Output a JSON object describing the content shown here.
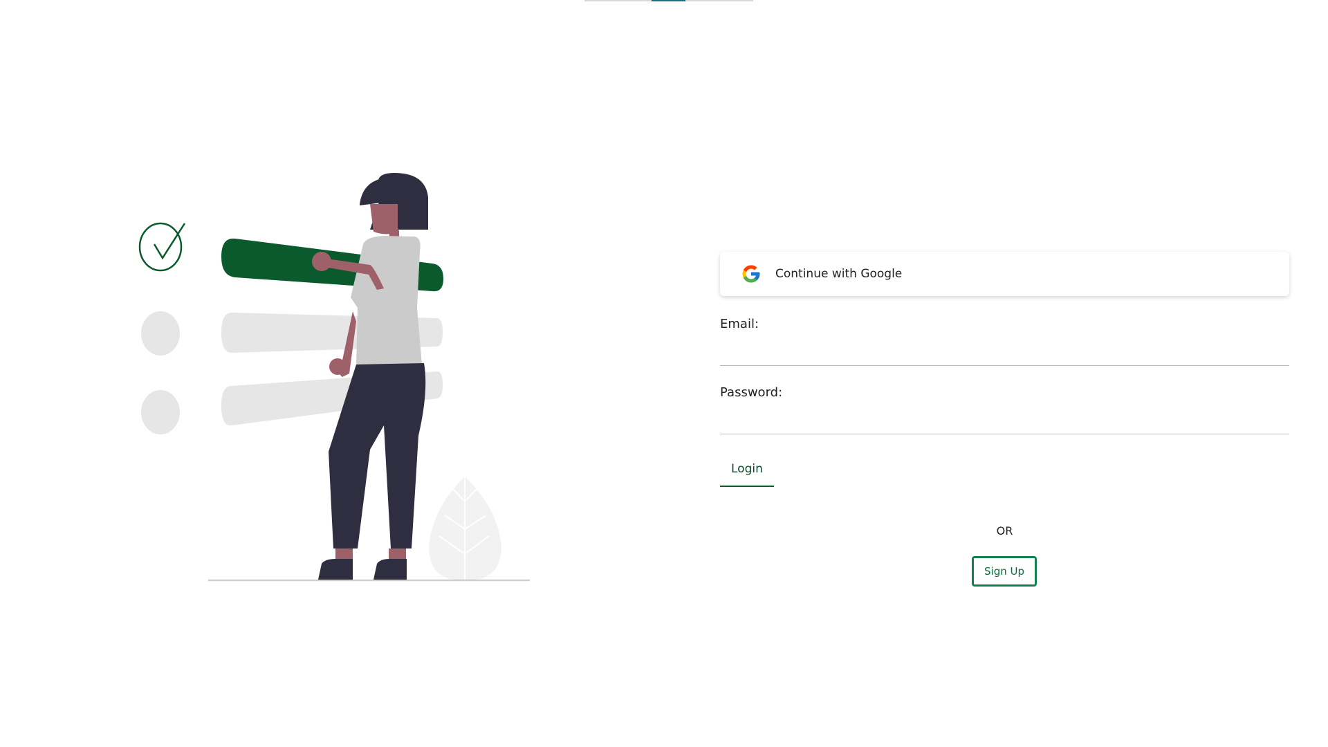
{
  "google_button": {
    "label": "Continue with Google",
    "icon": "google-icon"
  },
  "email": {
    "label": "Email:",
    "value": "",
    "placeholder": ""
  },
  "password": {
    "label": "Password:",
    "value": "",
    "placeholder": ""
  },
  "login": {
    "label": "Login"
  },
  "divider": {
    "text": "OR"
  },
  "signup": {
    "label": "Sign Up"
  },
  "colors": {
    "accent_green": "#0b5a2e",
    "signup_border": "#12804f",
    "illustration_gray": "#e6e6e6",
    "figure_dark": "#2f2e41",
    "skin": "#9e616a",
    "shirt": "#cbcbcb"
  },
  "illustration": {
    "name": "checklist-illustration",
    "icons": [
      "check-circle-icon",
      "woman-figure",
      "leaf-plant-icon"
    ]
  }
}
